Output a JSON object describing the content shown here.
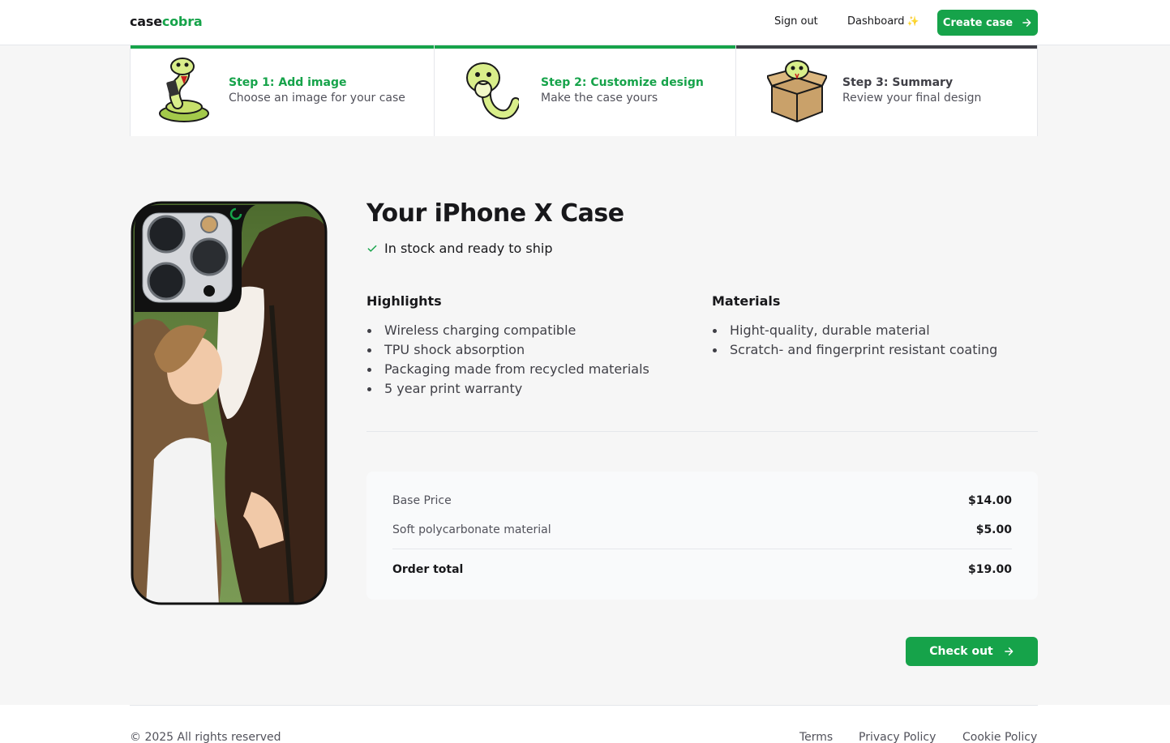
{
  "nav": {
    "logo_a": "case",
    "logo_b": "cobra",
    "sign_out": "Sign out",
    "dashboard": "Dashboard",
    "dashboard_icon": "sparkle-icon",
    "create_case": "Create case",
    "arrow_icon": "arrow-right-icon"
  },
  "steps": [
    {
      "title": "Step 1: Add image",
      "desc": "Choose an image for your case",
      "state": "complete",
      "image": "snake-with-phone-illustration"
    },
    {
      "title": "Step 2: Customize design",
      "desc": "Make the case yours",
      "state": "complete",
      "image": "snake-illustration"
    },
    {
      "title": "Step 3: Summary",
      "desc": "Review your final design",
      "state": "current",
      "image": "snake-in-box-illustration"
    }
  ],
  "product": {
    "title": "Your iPhone X Case",
    "stock": "In stock and ready to ship",
    "image": "phone-case-preview-woman-kissing-horse"
  },
  "highlights": {
    "heading": "Highlights",
    "items": [
      "Wireless charging compatible",
      "TPU shock absorption",
      "Packaging made from recycled materials",
      "5 year print warranty"
    ]
  },
  "materials": {
    "heading": "Materials",
    "items": [
      "Hight-quality, durable material",
      "Scratch- and fingerprint resistant coating"
    ]
  },
  "pricing": {
    "rows": [
      {
        "label": "Base Price",
        "value": "$14.00"
      },
      {
        "label": "Soft polycarbonate material",
        "value": "$5.00"
      }
    ],
    "total_label": "Order total",
    "total_value": "$19.00"
  },
  "checkout": {
    "label": "Check out"
  },
  "footer": {
    "copyright": "© 2025 All rights reserved",
    "links": [
      "Terms",
      "Privacy Policy",
      "Cookie Policy"
    ]
  },
  "colors": {
    "accent": "#16a34a",
    "text": "#18181b",
    "muted": "#52525b"
  }
}
